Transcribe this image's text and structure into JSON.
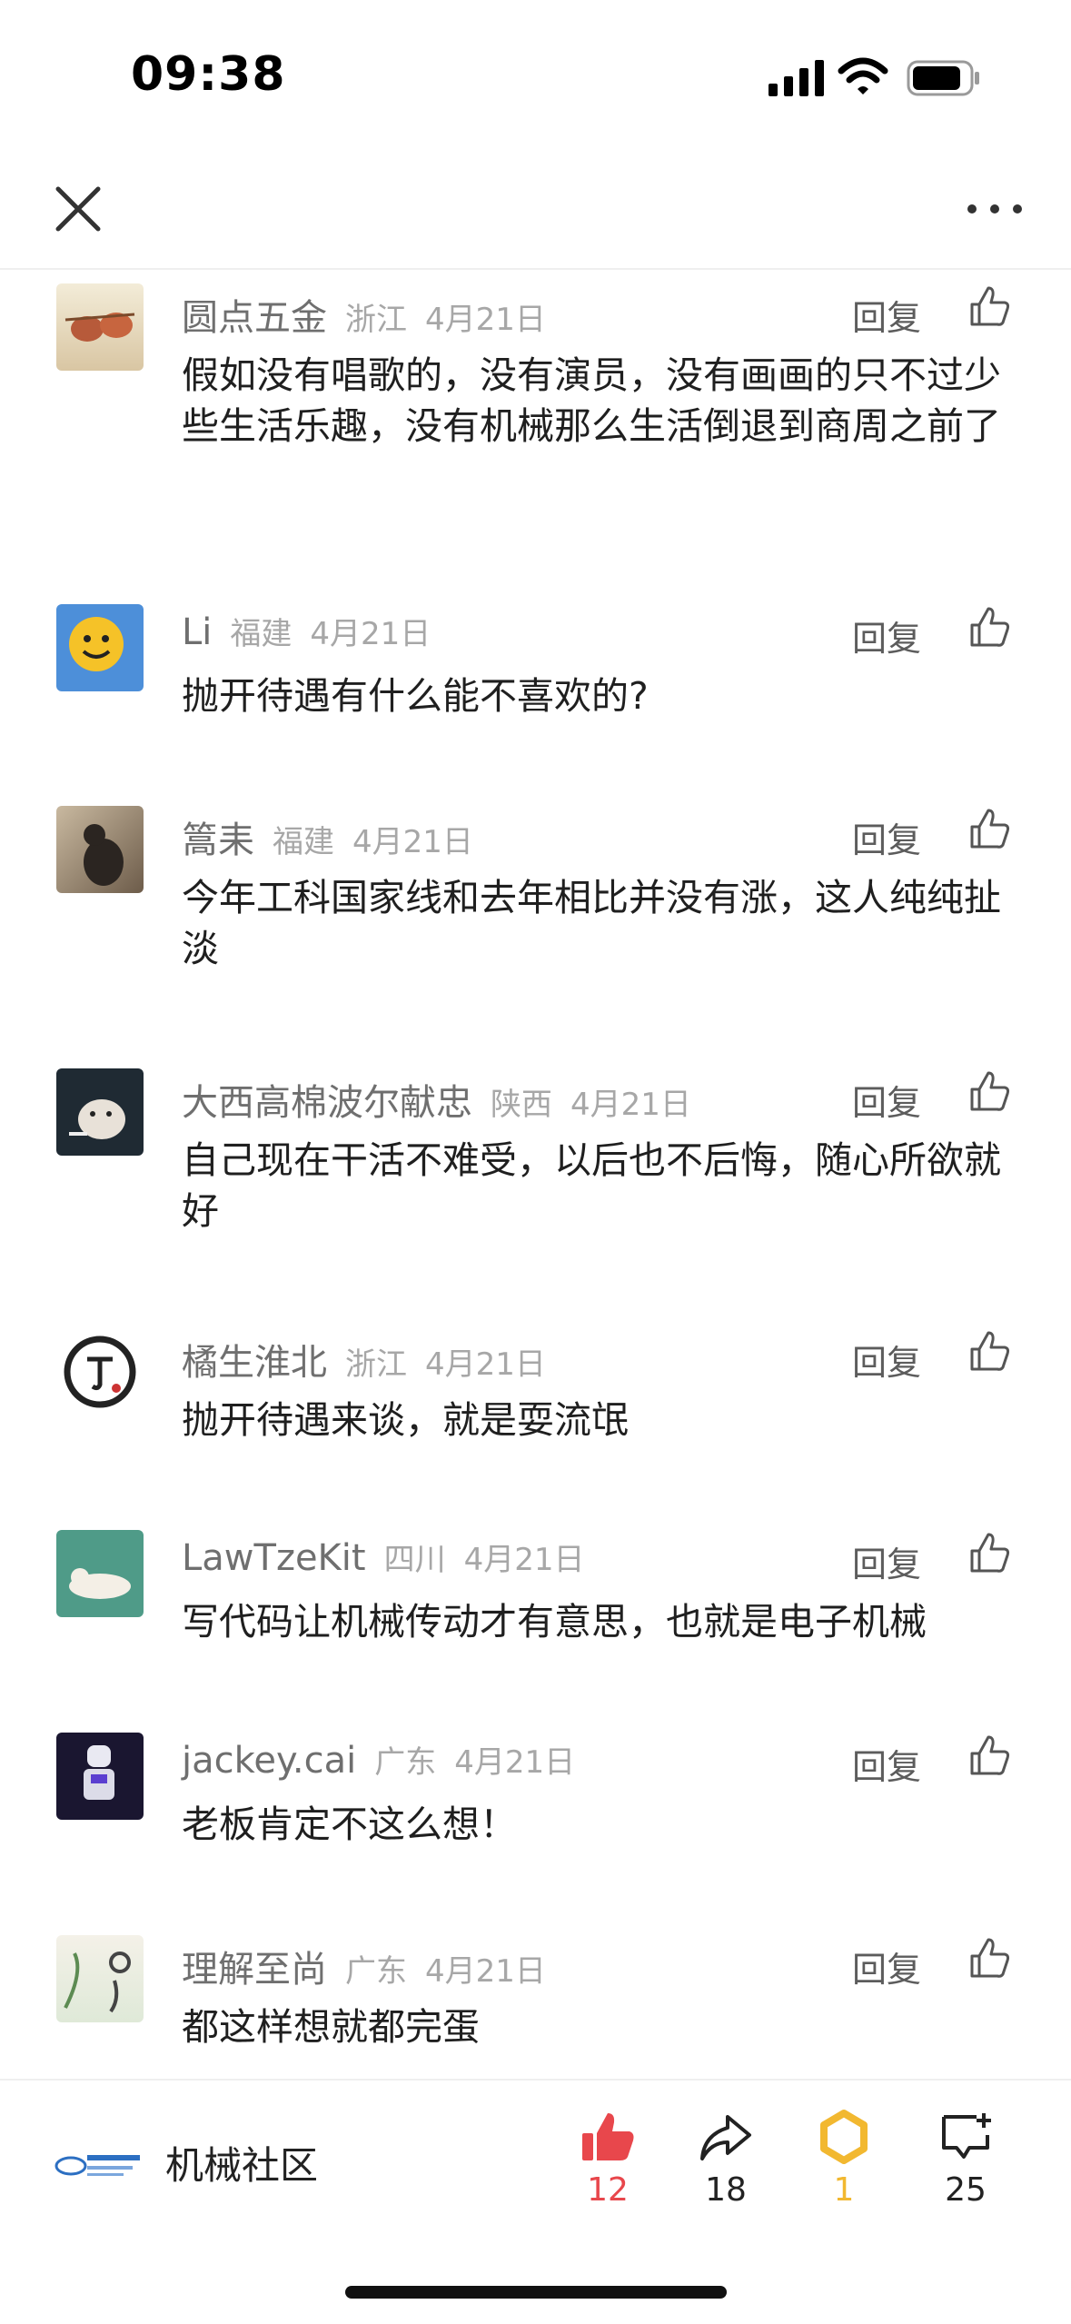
{
  "status": {
    "time": "09:38"
  },
  "comments": [
    {
      "name": "圆点五金",
      "region": "浙江",
      "date": "4月21日",
      "reply": "回复",
      "text": "假如没有唱歌的，没有演员，没有画画的只不过少些生活乐趣，没有机械那么生活倒退到商周之前了"
    },
    {
      "name": "Li",
      "region": "福建",
      "date": "4月21日",
      "reply": "回复",
      "text": "抛开待遇有什么能不喜欢的?"
    },
    {
      "name": "篙耒",
      "region": "福建",
      "date": "4月21日",
      "reply": "回复",
      "text": "今年工科国家线和去年相比并没有涨，这人纯纯扯淡"
    },
    {
      "name": "大西高棉波尔献忠",
      "region": "陕西",
      "date": "4月21日",
      "reply": "回复",
      "text": "自己现在干活不难受，以后也不后悔，随心所欲就好"
    },
    {
      "name": "橘生淮北",
      "region": "浙江",
      "date": "4月21日",
      "reply": "回复",
      "text": "抛开待遇来谈，就是耍流氓"
    },
    {
      "name": "LawTzeKit",
      "region": "四川",
      "date": "4月21日",
      "reply": "回复",
      "text": "写代码让机械传动才有意思，也就是电子机械"
    },
    {
      "name": "jackey.cai",
      "region": "广东",
      "date": "4月21日",
      "reply": "回复",
      "text": "老板肯定不这么想！"
    },
    {
      "name": "理解至尚",
      "region": "广东",
      "date": "4月21日",
      "reply": "回复",
      "text": "都这样想就都完蛋"
    }
  ],
  "footer": {
    "brand": "机械社区",
    "like_count": "12",
    "share_count": "18",
    "star_count": "1",
    "comment_count": "25",
    "colors": {
      "like": "#e8474c",
      "star": "#f2b830"
    }
  }
}
